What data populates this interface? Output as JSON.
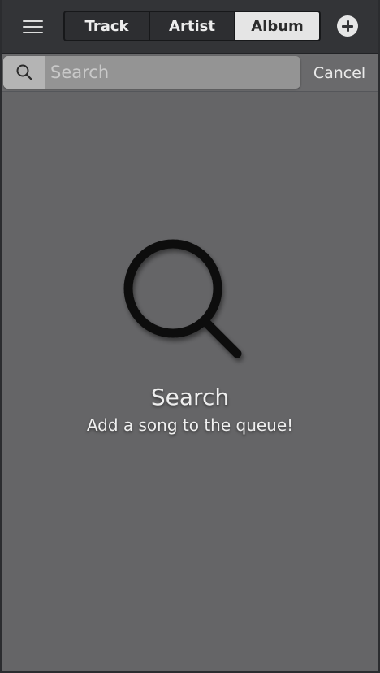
{
  "header": {
    "menu_icon": "hamburger-menu-icon",
    "tabs": [
      {
        "label": "Track",
        "active": false
      },
      {
        "label": "Artist",
        "active": false
      },
      {
        "label": "Album",
        "active": true
      }
    ],
    "add_icon": "plus-circle-icon"
  },
  "search": {
    "icon": "search-icon",
    "placeholder": "Search",
    "value": "",
    "cancel_label": "Cancel"
  },
  "empty_state": {
    "icon": "magnifying-glass-icon",
    "title": "Search",
    "subtitle": "Add a song to the queue!"
  },
  "colors": {
    "background": "#656567",
    "topbar": "#333437",
    "active_tab": "#e5e5e5",
    "search_field": "#949494"
  }
}
